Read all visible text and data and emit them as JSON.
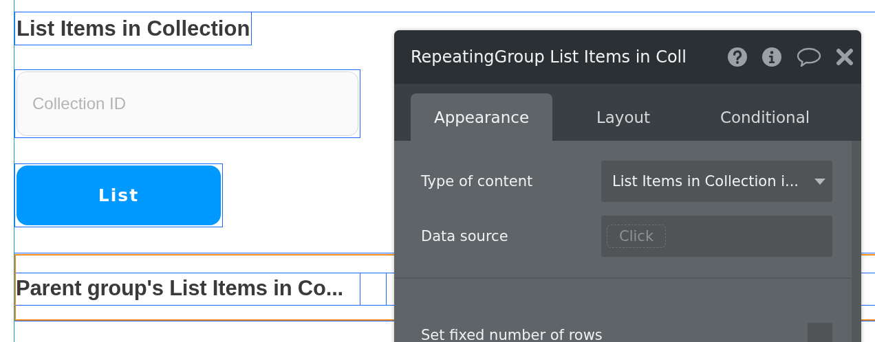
{
  "canvas": {
    "heading": "List Items in Collection",
    "input": {
      "placeholder": "Collection ID"
    },
    "button": "List",
    "repeating_group": {
      "cells": [
        {
          "text": "Parent group's List Items in Co..."
        }
      ]
    }
  },
  "panel": {
    "title": "RepeatingGroup List Items in Coll",
    "tabs": [
      {
        "label": "Appearance",
        "selected": true
      },
      {
        "label": "Layout",
        "selected": false
      },
      {
        "label": "Conditional",
        "selected": false
      }
    ],
    "fields": [
      {
        "kind": "dropdown",
        "label": "Type of content",
        "value": "List Items in Collection i..."
      },
      {
        "kind": "dynamic",
        "label": "Data source",
        "placeholder": "Click"
      }
    ],
    "options": [
      {
        "kind": "checkbox",
        "label": "Set fixed number of rows",
        "checked": false
      }
    ]
  }
}
